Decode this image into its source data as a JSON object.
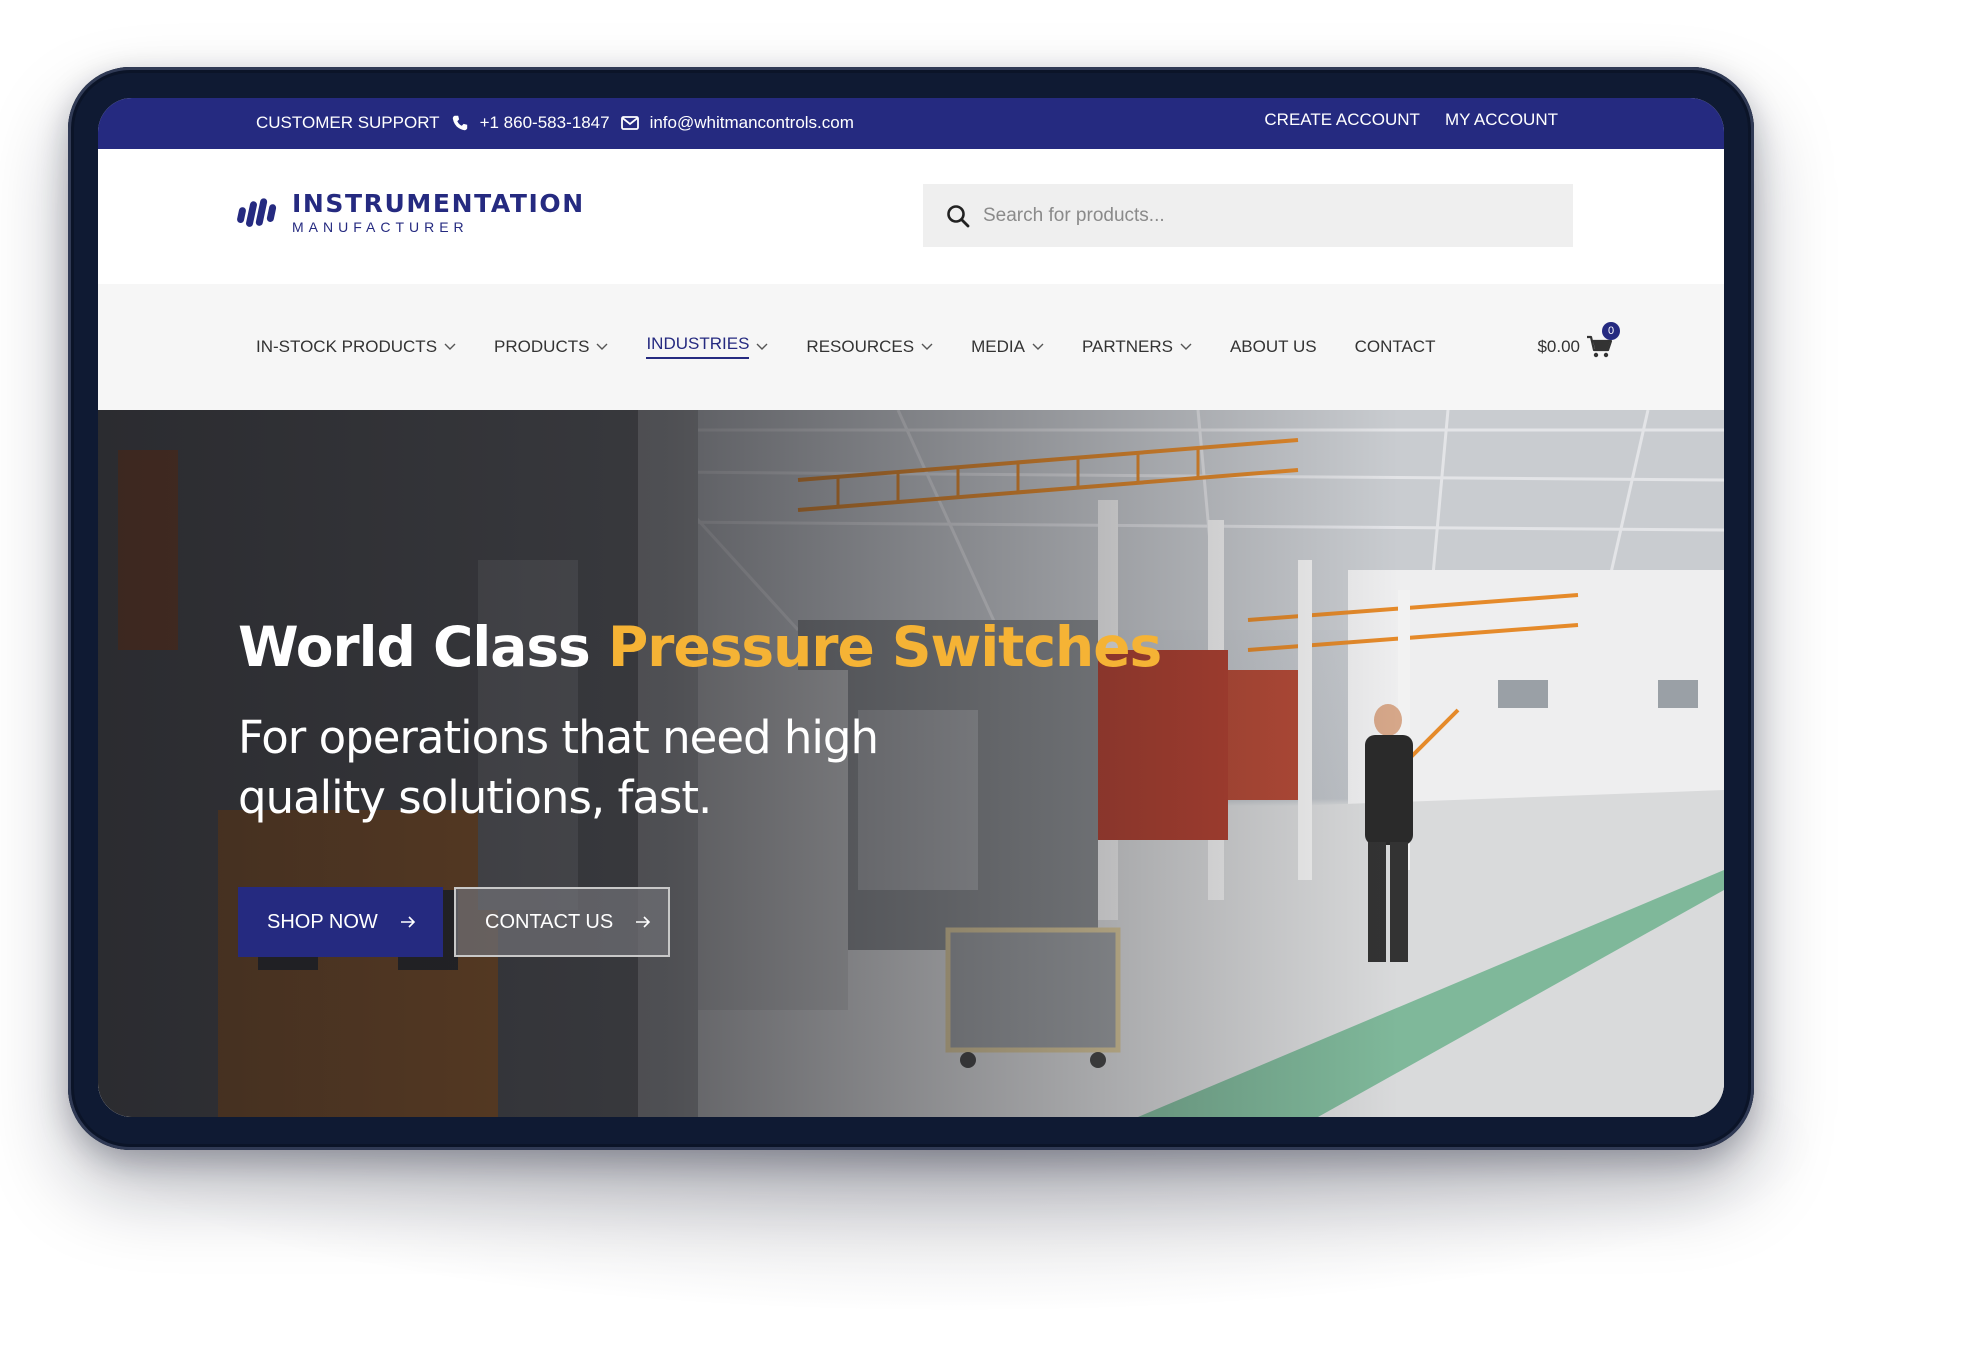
{
  "topbar": {
    "support_label": "CUSTOMER SUPPORT",
    "phone": "+1 860-583-1847",
    "email": "info@whitmancontrols.com",
    "create_account": "CREATE ACCOUNT",
    "my_account": "MY ACCOUNT"
  },
  "logo": {
    "line1": "INSTRUMENTATION",
    "line2": "MANUFACTURER"
  },
  "search": {
    "placeholder": "Search for products..."
  },
  "nav": {
    "items": [
      {
        "label": "IN-STOCK PRODUCTS",
        "dropdown": true
      },
      {
        "label": "PRODUCTS",
        "dropdown": true
      },
      {
        "label": "INDUSTRIES",
        "dropdown": true,
        "active": true
      },
      {
        "label": "RESOURCES",
        "dropdown": true
      },
      {
        "label": "MEDIA",
        "dropdown": true
      },
      {
        "label": "PARTNERS",
        "dropdown": true
      },
      {
        "label": "ABOUT US",
        "dropdown": false
      },
      {
        "label": "CONTACT",
        "dropdown": false
      }
    ]
  },
  "cart": {
    "total": "$0.00",
    "count": "0"
  },
  "hero": {
    "title_part1": "World Class ",
    "title_accent": "Pressure Switches",
    "subtitle": "For operations that need high quality solutions, fast.",
    "primary_button": "SHOP NOW",
    "secondary_button": "CONTACT US"
  },
  "colors": {
    "brand": "#252a80",
    "accent": "#f5b335",
    "device_frame": "#0f1a33"
  },
  "icons": [
    "phone-icon",
    "mail-icon",
    "search-icon",
    "chevron-down-icon",
    "cart-icon",
    "arrow-right-icon",
    "logo-bars-icon"
  ]
}
